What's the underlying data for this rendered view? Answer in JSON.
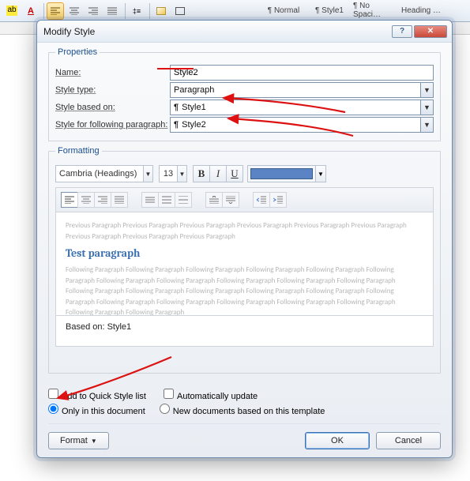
{
  "ribbon": {
    "styles": [
      "¶ Normal",
      "¶ Style1",
      "¶ No Spaci…",
      "Heading …"
    ]
  },
  "dialog": {
    "title": "Modify Style",
    "properties": {
      "legend": "Properties",
      "name_label": "Name:",
      "name_value": "Style2",
      "type_label": "Style type:",
      "type_value": "Paragraph",
      "based_label": "Style based on:",
      "based_value": "Style1",
      "following_label": "Style for following paragraph:",
      "following_value": "Style2"
    },
    "formatting": {
      "legend": "Formatting",
      "font_name": "Cambria (Headings)",
      "font_size": "13",
      "color": "#5b84c4"
    },
    "preview": {
      "prev_text": "Previous Paragraph Previous Paragraph Previous Paragraph Previous Paragraph Previous Paragraph Previous Paragraph Previous Paragraph Previous Paragraph Previous Paragraph",
      "sample": "Test paragraph",
      "next_text": "Following Paragraph Following Paragraph Following Paragraph Following Paragraph Following Paragraph Following Paragraph Following Paragraph Following Paragraph Following Paragraph Following Paragraph Following Paragraph Following Paragraph Following Paragraph Following Paragraph Following Paragraph Following Paragraph Following Paragraph Following Paragraph Following Paragraph Following Paragraph Following Paragraph Following Paragraph Following Paragraph Following Paragraph"
    },
    "summary": "Based on: Style1",
    "options": {
      "quick_style": "Add to Quick Style list",
      "auto_update": "Automatically update",
      "only_doc": "Only in this document",
      "new_docs": "New documents based on this template"
    },
    "buttons": {
      "format": "Format",
      "ok": "OK",
      "cancel": "Cancel"
    }
  }
}
